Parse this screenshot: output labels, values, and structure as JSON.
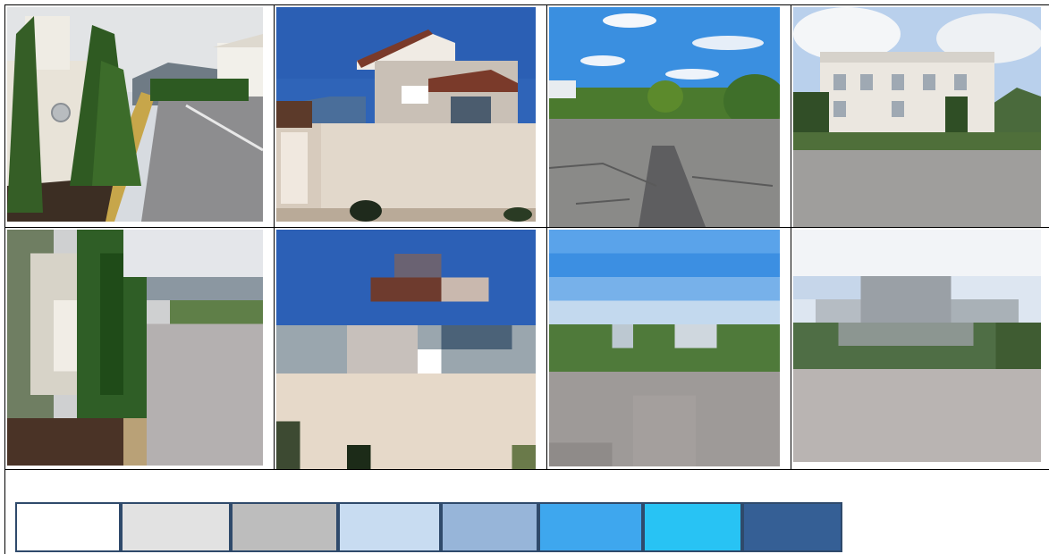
{
  "photos_row": [
    {
      "name": "photo-villa-street-cypress"
    },
    {
      "name": "photo-house-behind-wall"
    },
    {
      "name": "photo-cracked-road-trees"
    },
    {
      "name": "photo-apartment-building-street"
    }
  ],
  "pixelated_row": [
    {
      "name": "pixelated-villa-street-cypress"
    },
    {
      "name": "pixelated-house-behind-wall"
    },
    {
      "name": "pixelated-cracked-road-trees"
    },
    {
      "name": "pixelated-apartment-building-street"
    }
  ],
  "palette": {
    "colors": [
      "#ffffff",
      "#e2e2e2",
      "#bdbdbd",
      "#c8dcf1",
      "#97b5d9",
      "#3ea7ee",
      "#28c3f4",
      "#355f95"
    ]
  }
}
